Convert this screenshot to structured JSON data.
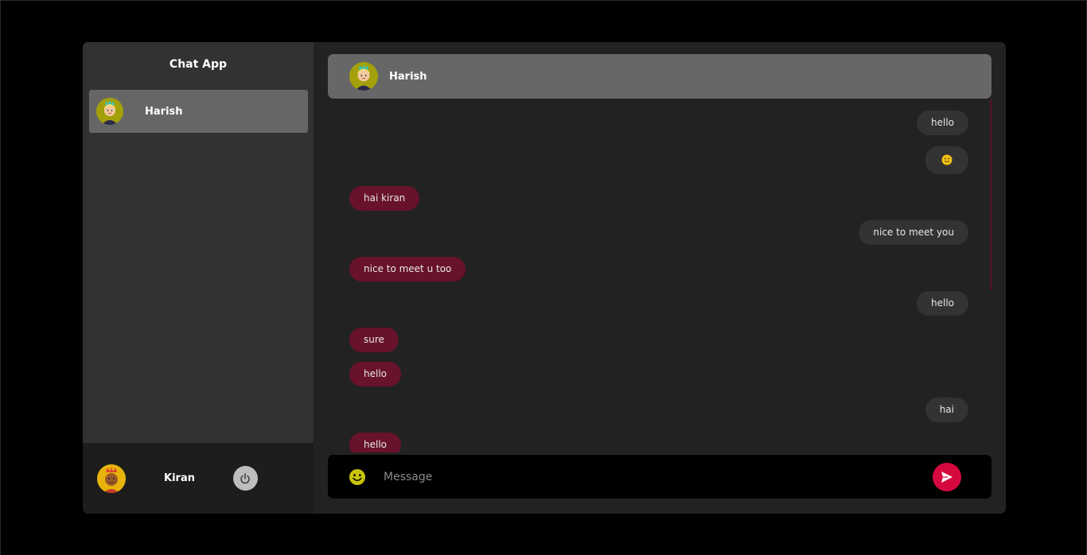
{
  "sidebar": {
    "title": "Chat App",
    "contacts": [
      {
        "name": "Harish",
        "icon": "avatar-harish"
      }
    ],
    "current_user": {
      "name": "Kiran",
      "icon": "avatar-kiran"
    },
    "logout_icon": "power-icon"
  },
  "chat": {
    "header": {
      "name": "Harish",
      "icon": "avatar-harish"
    },
    "messages": [
      {
        "text": "hello",
        "dir": "out"
      },
      {
        "text": "🙂",
        "dir": "out"
      },
      {
        "text": "hai kiran",
        "dir": "in"
      },
      {
        "text": "nice to meet you",
        "dir": "out"
      },
      {
        "text": "nice to meet u too",
        "dir": "in"
      },
      {
        "text": "hello",
        "dir": "out"
      },
      {
        "text": "sure",
        "dir": "in"
      },
      {
        "text": "hello",
        "dir": "in"
      },
      {
        "text": "hai",
        "dir": "out"
      },
      {
        "text": "hello",
        "dir": "in"
      }
    ],
    "composer": {
      "placeholder": "Message",
      "emoji_icon": "emoji-icon",
      "send_icon": "send-icon"
    }
  },
  "colors": {
    "accent": "#d6093f",
    "incoming_bubble": "#68122b",
    "outgoing_bubble": "#333333",
    "sidebar_bg": "#323232",
    "chat_bg": "#222222"
  }
}
